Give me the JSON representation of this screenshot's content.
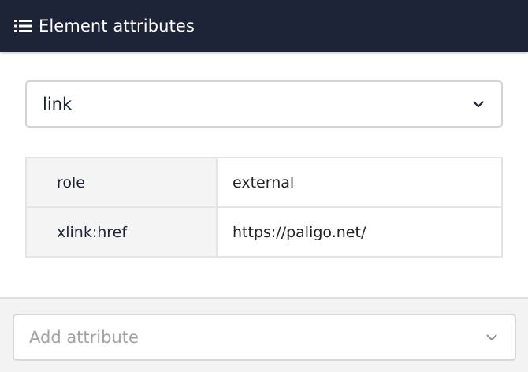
{
  "header": {
    "title": "Element attributes",
    "icon": "list-icon"
  },
  "element_select": {
    "value": "link",
    "icon": "chevron-down-icon"
  },
  "attributes": [
    {
      "name": "role",
      "value": "external"
    },
    {
      "name": "xlink:href",
      "value": "https://paligo.net/"
    }
  ],
  "add_attribute": {
    "placeholder": "Add attribute",
    "icon": "chevron-down-icon"
  },
  "colors": {
    "header_bg": "#1d2438",
    "key_cell_bg": "#f4f4f4",
    "footer_bg": "#f3f3f3"
  }
}
